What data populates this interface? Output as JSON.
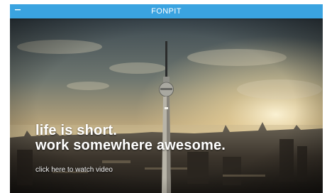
{
  "app_bar": {
    "title": "FONPIT",
    "menu_icon": "menu-icon",
    "color": "#3aa3e0"
  },
  "hero": {
    "headline_line1": "life is short.",
    "headline_line2": "work somewhere awesome.",
    "link_text": "click here to watch video",
    "image_subject": "tv-tower-skyline-image"
  }
}
